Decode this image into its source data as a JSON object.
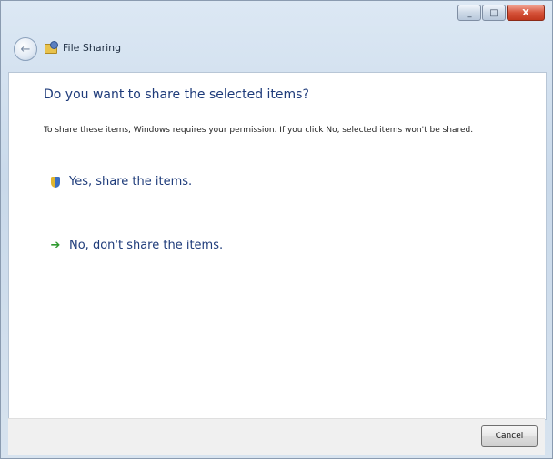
{
  "window": {
    "nav_title": "File Sharing",
    "caption": {
      "minimize": "_",
      "maximize": "□",
      "close": "X"
    },
    "back_glyph": "←"
  },
  "dialog": {
    "heading": "Do you want to share the selected items?",
    "description": "To share these items, Windows requires your permission. If you click No, selected items won't be shared.",
    "options": [
      {
        "label": "Yes, share the items.",
        "icon": "uac-shield-icon"
      },
      {
        "label": "No, don't share the items.",
        "icon": "green-arrow-icon",
        "arrow_glyph": "➔"
      }
    ]
  },
  "footer": {
    "cancel_label": "Cancel"
  },
  "colors": {
    "heading": "#1e3b7a",
    "option_text": "#1e3b7a",
    "close_button": "#c2381e",
    "arrow": "#2f9a2f"
  }
}
